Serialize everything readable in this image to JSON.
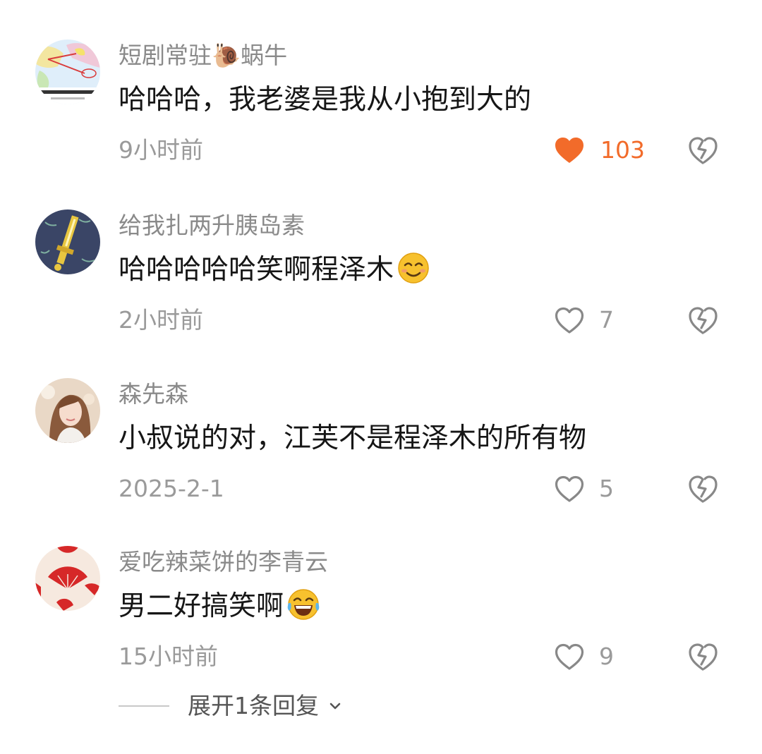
{
  "comments": [
    {
      "username": "短剧常驻🐌蜗牛",
      "text": "哈哈哈，我老婆是我从小抱到大的",
      "time": "9小时前",
      "likes": "103",
      "liked": true
    },
    {
      "username": "给我扎两升胰岛素",
      "text": "哈哈哈哈哈笑啊程泽木",
      "time": "2小时前",
      "likes": "7",
      "liked": false
    },
    {
      "username": "森先森",
      "text": "小叔说的对，江芙不是程泽木的所有物",
      "time": "2025-2-1",
      "likes": "5",
      "liked": false
    },
    {
      "username": "爱吃辣菜饼的李青云",
      "text": "男二好搞笑啊",
      "time": "15小时前",
      "likes": "9",
      "liked": false
    }
  ],
  "expand_replies": {
    "label": "展开1条回复"
  },
  "colors": {
    "liked": "#f26b2a",
    "meta": "#9a9a9a",
    "text": "#161616"
  }
}
